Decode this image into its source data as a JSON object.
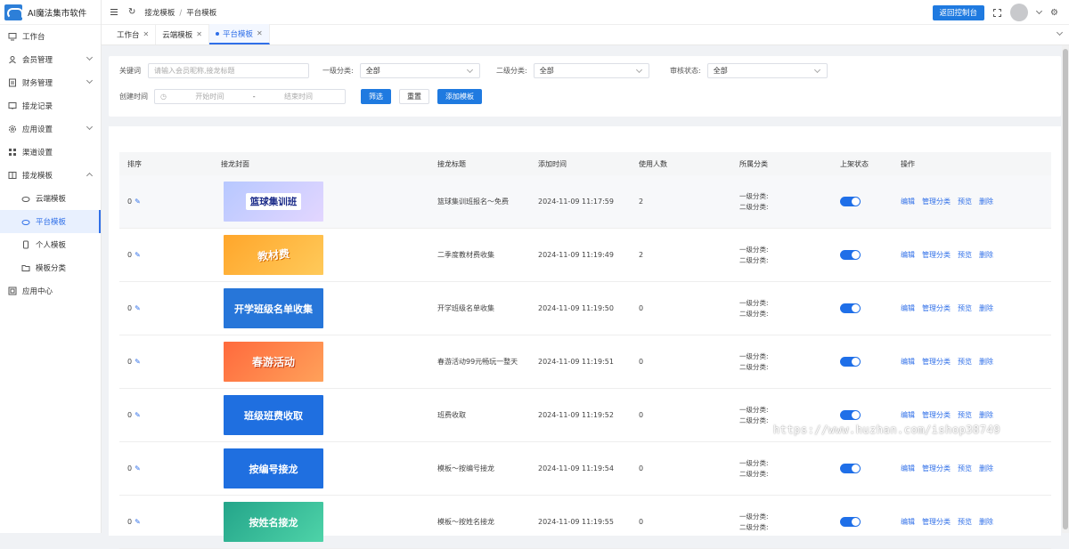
{
  "app": {
    "title": "AI魔法集市软件"
  },
  "sidebar": {
    "items": [
      {
        "label": "工作台",
        "icon": "monitor-icon"
      },
      {
        "label": "会员管理",
        "icon": "user-icon"
      },
      {
        "label": "财务管理",
        "icon": "finance-icon"
      },
      {
        "label": "接龙记录",
        "icon": "record-icon"
      },
      {
        "label": "应用设置",
        "icon": "gear-icon"
      },
      {
        "label": "渠道设置",
        "icon": "grid-icon"
      },
      {
        "label": "接龙模板",
        "icon": "template-icon"
      },
      {
        "label": "云端模板",
        "icon": "cloud-icon"
      },
      {
        "label": "平台模板",
        "icon": "cloud-icon"
      },
      {
        "label": "个人模板",
        "icon": "phone-icon"
      },
      {
        "label": "模板分类",
        "icon": "folder-icon"
      },
      {
        "label": "应用中心",
        "icon": "app-icon"
      }
    ]
  },
  "header": {
    "breadcrumb": [
      "接龙模板",
      "平台模板"
    ],
    "console_button": "返回控制台"
  },
  "tabs": [
    {
      "label": "工作台"
    },
    {
      "label": "云端模板"
    },
    {
      "label": "平台模板"
    }
  ],
  "filter": {
    "keyword_label": "关键词",
    "keyword_placeholder": "请输入会员昵称,接龙标题",
    "cat1_label": "一级分类:",
    "cat1_value": "全部",
    "cat2_label": "二级分类:",
    "cat2_value": "全部",
    "review_label": "审核状态:",
    "review_value": "全部",
    "created_label": "创建时间",
    "start_placeholder": "开始时间",
    "range_sep": "-",
    "end_placeholder": "结束时间",
    "filter_button": "筛选",
    "reset_button": "重置",
    "add_button": "添加模板"
  },
  "table": {
    "headers": [
      "排序",
      "接龙封面",
      "接龙标题",
      "添加时间",
      "使用人数",
      "所属分类",
      "上架状态",
      "操作"
    ],
    "cat1_text": "一级分类:",
    "cat2_text": "二级分类:",
    "ops": [
      "编辑",
      "管理分类",
      "预览",
      "删除"
    ],
    "rows": [
      {
        "sort": "0",
        "cover_text": "篮球集训班",
        "title": "篮球集训班报名～免费",
        "time": "2024-11-09 11:17:59",
        "users": "2",
        "on_shelf": true
      },
      {
        "sort": "0",
        "cover_text": "教材费",
        "title": "二季度教材费收集",
        "time": "2024-11-09 11:19:49",
        "users": "2",
        "on_shelf": true
      },
      {
        "sort": "0",
        "cover_text": "开学班级名单收集",
        "title": "开学班级名单收集",
        "time": "2024-11-09 11:19:50",
        "users": "0",
        "on_shelf": true
      },
      {
        "sort": "0",
        "cover_text": "春游活动",
        "title": "春游活动99元畅玩一整天",
        "time": "2024-11-09 11:19:51",
        "users": "0",
        "on_shelf": true
      },
      {
        "sort": "0",
        "cover_text": "班级班费收取",
        "title": "班费收取",
        "time": "2024-11-09 11:19:52",
        "users": "0",
        "on_shelf": true
      },
      {
        "sort": "0",
        "cover_text": "按编号接龙",
        "title": "模板～按编号接龙",
        "time": "2024-11-09 11:19:54",
        "users": "0",
        "on_shelf": true
      },
      {
        "sort": "0",
        "cover_text": "按姓名接龙",
        "title": "模板～按姓名接龙",
        "time": "2024-11-09 11:19:55",
        "users": "0",
        "on_shelf": true
      }
    ]
  },
  "watermark": "https://www.huzhan.com/ishop38749"
}
